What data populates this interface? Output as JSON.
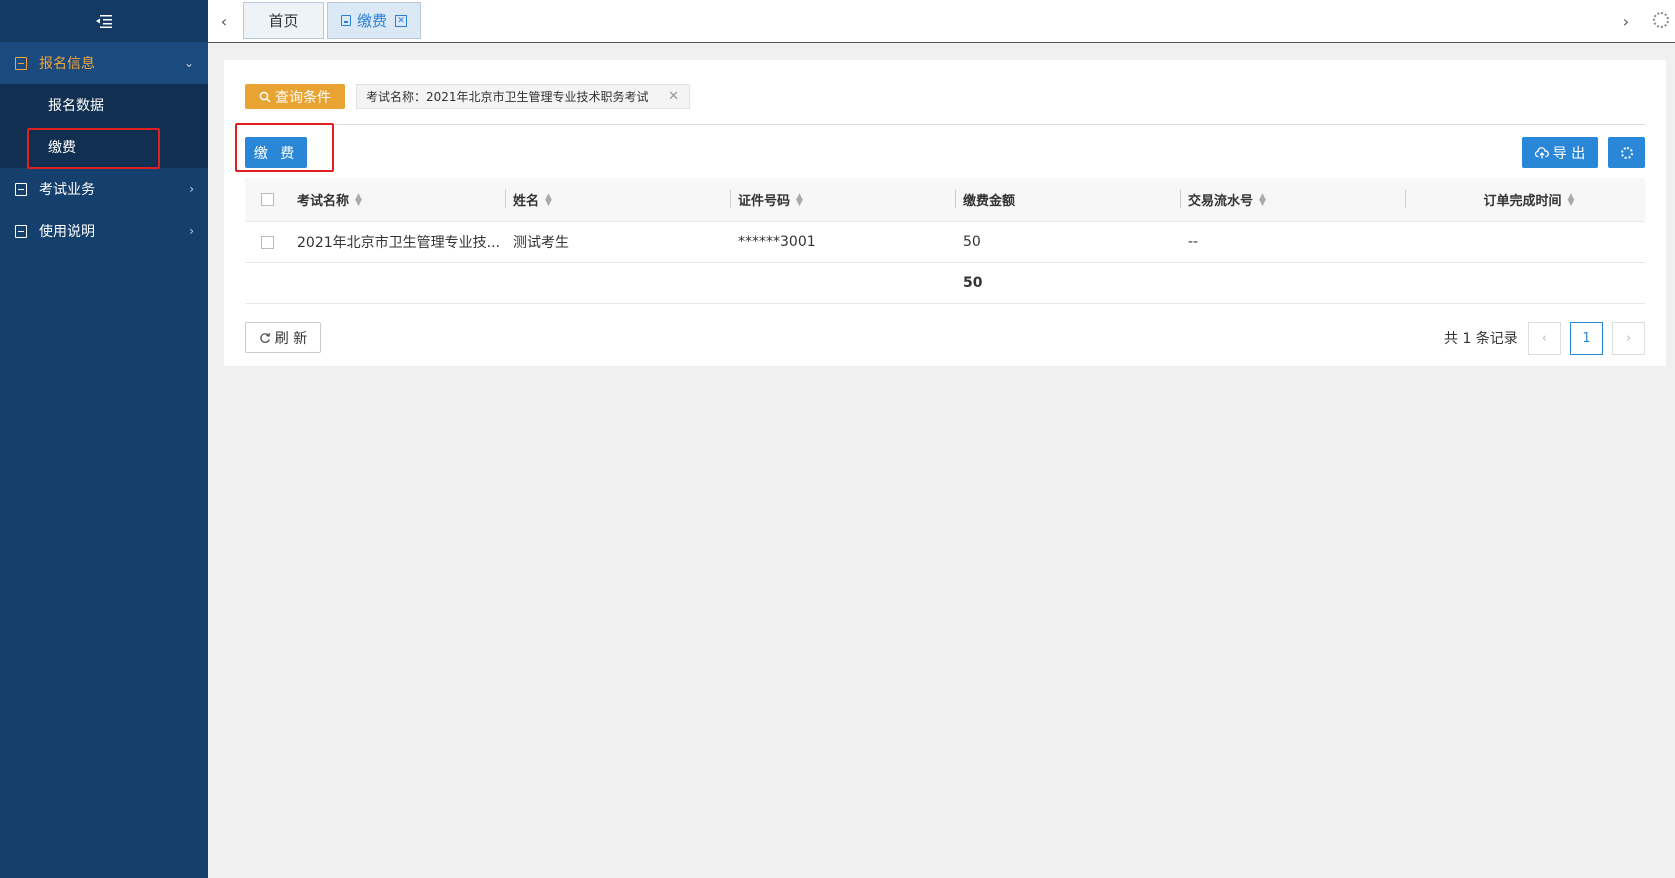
{
  "sidebar": {
    "groups": [
      {
        "label": "报名信息",
        "expanded": true,
        "items": [
          {
            "label": "报名数据"
          },
          {
            "label": "缴费"
          }
        ]
      },
      {
        "label": "考试业务"
      },
      {
        "label": "使用说明"
      }
    ]
  },
  "tabs": [
    {
      "label": "首页"
    },
    {
      "label": "缴费",
      "active": true
    }
  ],
  "filter": {
    "query_label": "查询条件",
    "condition_chip": "考试名称：2021年北京市卫生管理专业技术职务考试"
  },
  "toolbar": {
    "pay_label": "缴 费",
    "export_label": "导 出"
  },
  "table": {
    "columns": [
      "考试名称",
      "姓名",
      "证件号码",
      "缴费金额",
      "交易流水号",
      "订单完成时间"
    ],
    "rows": [
      {
        "exam": "2021年北京市卫生管理专业技...",
        "name": "测试考生",
        "id_no": "******3001",
        "amount": "50",
        "txn": "--",
        "time": ""
      }
    ],
    "total_amount": "50"
  },
  "footer": {
    "refresh_label": "刷 新",
    "record_count": "共 1 条记录",
    "current_page": "1"
  },
  "colors": {
    "sidebar_bg": "#153f6d",
    "accent_orange": "#e8a333",
    "primary_blue": "#2a86d6",
    "highlight_red": "#e02020"
  }
}
